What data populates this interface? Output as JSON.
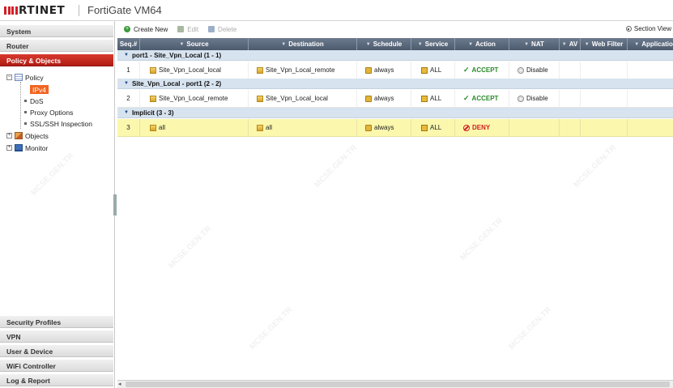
{
  "app": {
    "brand": "RTINET",
    "product": "FortiGate VM64"
  },
  "sidebar": {
    "top_sections": [
      {
        "label": "System",
        "active": false
      },
      {
        "label": "Router",
        "active": false
      },
      {
        "label": "Policy & Objects",
        "active": true
      }
    ],
    "tree": {
      "policy": "Policy",
      "ipv4": "IPv4",
      "dos": "DoS",
      "proxy": "Proxy Options",
      "ssl": "SSL/SSH Inspection",
      "objects": "Objects",
      "monitor": "Monitor"
    },
    "bottom_sections": [
      {
        "label": "Security Profiles"
      },
      {
        "label": "VPN"
      },
      {
        "label": "User & Device"
      },
      {
        "label": "WiFi Controller"
      },
      {
        "label": "Log & Report"
      }
    ]
  },
  "toolbar": {
    "create_new": "Create New",
    "edit": "Edit",
    "delete": "Delete",
    "section_view": "Section View"
  },
  "table": {
    "columns": [
      "Seq.#",
      "Source",
      "Destination",
      "Schedule",
      "Service",
      "Action",
      "NAT",
      "AV",
      "Web Filter",
      "Application"
    ],
    "sections": [
      {
        "title": "port1 - Site_Vpn_Local (1 - 1)",
        "rows": [
          {
            "seq": "1",
            "source": "Site_Vpn_Local_local",
            "destination": "Site_Vpn_Local_remote",
            "schedule": "always",
            "service": "ALL",
            "action": "ACCEPT",
            "nat": "Disable"
          }
        ]
      },
      {
        "title": "Site_Vpn_Local - port1 (2 - 2)",
        "rows": [
          {
            "seq": "2",
            "source": "Site_Vpn_Local_remote",
            "destination": "Site_Vpn_Local_local",
            "schedule": "always",
            "service": "ALL",
            "action": "ACCEPT",
            "nat": "Disable"
          }
        ]
      },
      {
        "title": "Implicit (3 - 3)",
        "rows": [
          {
            "seq": "3",
            "source": "all",
            "destination": "all",
            "schedule": "always",
            "service": "ALL",
            "action": "DENY",
            "nat": ""
          }
        ]
      }
    ]
  },
  "colors": {
    "brand_red": "#d02027",
    "active_nav": "#c0271c",
    "selected_tree": "#f26522",
    "header_bg": "#56647a",
    "section_bg": "#d7e3ef",
    "deny_row_bg": "#fbf7ad",
    "accept": "#2a8a2a",
    "deny": "#d02020"
  },
  "watermark": "MCSE.GEN.TR"
}
